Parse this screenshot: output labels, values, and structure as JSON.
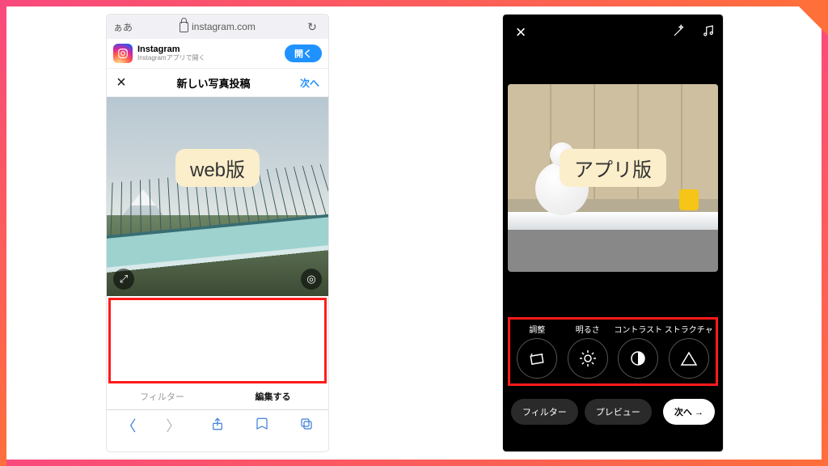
{
  "labels": {
    "web": "web版",
    "app": "アプリ版"
  },
  "safari": {
    "aa": "ぁあ",
    "url": "instagram.com",
    "toolbar": {
      "back": "〈",
      "fwd": "〉",
      "share": "share",
      "book": "book",
      "tabs": "tabs"
    }
  },
  "banner": {
    "title": "Instagram",
    "subtitle": "Instagramアプリで開く",
    "button": "開く"
  },
  "post_header": {
    "close": "×",
    "title": "新しい写真投稿",
    "next": "次へ"
  },
  "web_tabs": {
    "filter": "フィルター",
    "edit": "編集する"
  },
  "app": {
    "close": "×",
    "tools": [
      {
        "id": "adjust",
        "label": "調整"
      },
      {
        "id": "brightness",
        "label": "明るさ"
      },
      {
        "id": "contrast",
        "label": "コントラスト"
      },
      {
        "id": "structure",
        "label": "ストラクチャ"
      }
    ],
    "bottom": {
      "filter": "フィルター",
      "preview": "プレビュー",
      "next": "次へ →"
    }
  }
}
